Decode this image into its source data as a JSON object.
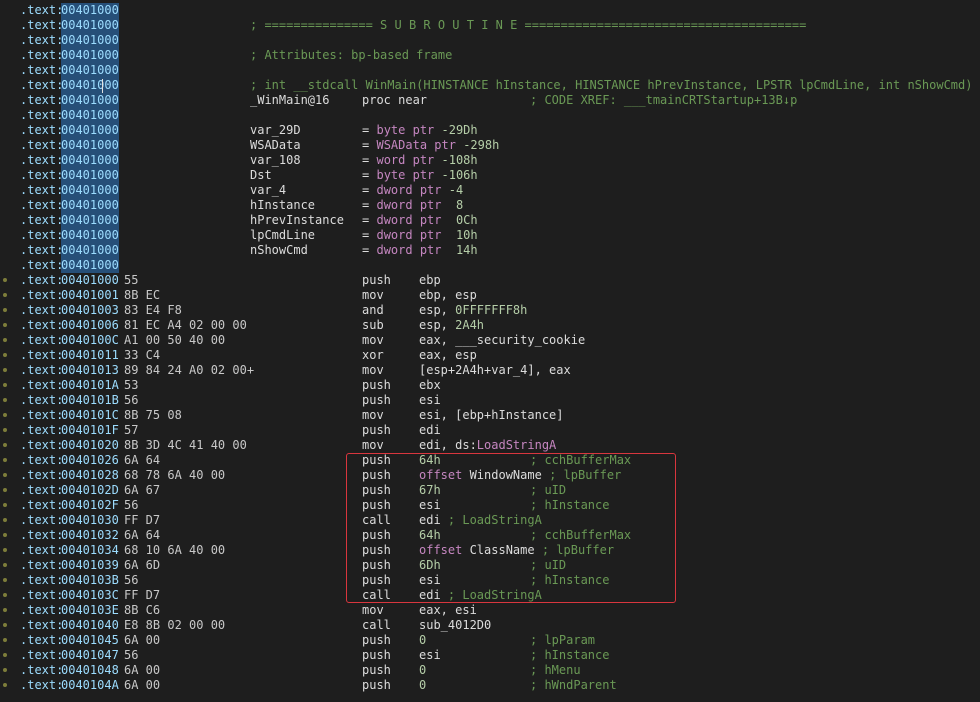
{
  "section": ".text:",
  "highlight_rows": 18,
  "lines": [
    {
      "addr": "00401000",
      "bytes": "",
      "kind": "blank"
    },
    {
      "addr": "00401000",
      "bytes": "",
      "kind": "full",
      "text": "; =============== S U B R O U T I N E ======================================="
    },
    {
      "addr": "00401000",
      "bytes": "",
      "kind": "blank"
    },
    {
      "addr": "00401000",
      "bytes": "",
      "kind": "full",
      "text": "; Attributes: bp-based frame"
    },
    {
      "addr": "00401000",
      "bytes": "",
      "kind": "blank"
    },
    {
      "addr": "00401000",
      "bytes": "",
      "kind": "full",
      "text": "; int __stdcall WinMain(HINSTANCE hInstance, HINSTANCE hPrevInstance, LPSTR lpCmdLine, int nShowCmd)"
    },
    {
      "addr": "00401000",
      "bytes": "",
      "kind": "proc",
      "label": "_WinMain@16",
      "mn": "proc near",
      "cm": "; CODE XREF: ___tmainCRTStartup+13B↓p"
    },
    {
      "addr": "00401000",
      "bytes": "",
      "kind": "blank"
    },
    {
      "addr": "00401000",
      "bytes": "",
      "kind": "var",
      "label": "var_29D",
      "eq": "=",
      "type": "byte ptr",
      "val": "-29Dh"
    },
    {
      "addr": "00401000",
      "bytes": "",
      "kind": "var",
      "label": "WSAData",
      "eq": "=",
      "type": "WSAData ptr",
      "val": "-298h"
    },
    {
      "addr": "00401000",
      "bytes": "",
      "kind": "var",
      "label": "var_108",
      "eq": "=",
      "type": "word ptr",
      "val": "-108h"
    },
    {
      "addr": "00401000",
      "bytes": "",
      "kind": "var",
      "label": "Dst",
      "eq": "=",
      "type": "byte ptr",
      "val": "-106h"
    },
    {
      "addr": "00401000",
      "bytes": "",
      "kind": "var",
      "label": "var_4",
      "eq": "=",
      "type": "dword ptr",
      "val": "-4"
    },
    {
      "addr": "00401000",
      "bytes": "",
      "kind": "var",
      "label": "hInstance",
      "eq": "=",
      "type": "dword ptr",
      "val": " 8"
    },
    {
      "addr": "00401000",
      "bytes": "",
      "kind": "var",
      "label": "hPrevInstance",
      "eq": "=",
      "type": "dword ptr",
      "val": " 0Ch"
    },
    {
      "addr": "00401000",
      "bytes": "",
      "kind": "var",
      "label": "lpCmdLine",
      "eq": "=",
      "type": "dword ptr",
      "val": " 10h"
    },
    {
      "addr": "00401000",
      "bytes": "",
      "kind": "var",
      "label": "nShowCmd",
      "eq": "=",
      "type": "dword ptr",
      "val": " 14h"
    },
    {
      "addr": "00401000",
      "bytes": "",
      "kind": "blank"
    },
    {
      "addr": "00401000",
      "bytes": "55",
      "kind": "ins",
      "dot": true,
      "mn": "push",
      "op": "ebp"
    },
    {
      "addr": "00401001",
      "bytes": "8B EC",
      "kind": "ins",
      "dot": true,
      "mn": "mov",
      "op": "ebp, esp"
    },
    {
      "addr": "00401003",
      "bytes": "83 E4 F8",
      "kind": "ins",
      "dot": true,
      "mn": "and",
      "op": "esp, ",
      "opn": "0FFFFFFF8h"
    },
    {
      "addr": "00401006",
      "bytes": "81 EC A4 02 00 00",
      "kind": "ins",
      "dot": true,
      "mn": "sub",
      "op": "esp, ",
      "opn": "2A4h"
    },
    {
      "addr": "0040100C",
      "bytes": "A1 00 50 40 00",
      "kind": "ins",
      "dot": true,
      "mn": "mov",
      "op": "eax, ___security_cookie"
    },
    {
      "addr": "00401011",
      "bytes": "33 C4",
      "kind": "ins",
      "dot": true,
      "mn": "xor",
      "op": "eax, esp"
    },
    {
      "addr": "00401013",
      "bytes": "89 84 24 A0 02 00+",
      "kind": "ins",
      "dot": true,
      "mn": "mov",
      "op": "[esp+2A4h+var_4], eax"
    },
    {
      "addr": "0040101A",
      "bytes": "53",
      "kind": "ins",
      "dot": true,
      "mn": "push",
      "op": "ebx"
    },
    {
      "addr": "0040101B",
      "bytes": "56",
      "kind": "ins",
      "dot": true,
      "mn": "push",
      "op": "esi"
    },
    {
      "addr": "0040101C",
      "bytes": "8B 75 08",
      "kind": "ins",
      "dot": true,
      "mn": "mov",
      "op": "esi, [ebp+hInstance]"
    },
    {
      "addr": "0040101F",
      "bytes": "57",
      "kind": "ins",
      "dot": true,
      "mn": "push",
      "op": "edi"
    },
    {
      "addr": "00401020",
      "bytes": "8B 3D 4C 41 40 00",
      "kind": "ins",
      "dot": true,
      "mn": "mov",
      "op": "edi, ds:",
      "opk": "LoadStringA"
    },
    {
      "addr": "00401026",
      "bytes": "6A 64",
      "kind": "ins",
      "dot": true,
      "mn": "push",
      "opn": "64h",
      "cm": "; cchBufferMax"
    },
    {
      "addr": "00401028",
      "bytes": "68 78 6A 40 00",
      "kind": "ins",
      "dot": true,
      "mn": "push",
      "opk": "offset",
      "op": " WindowName",
      "cmi": " ; lpBuffer"
    },
    {
      "addr": "0040102D",
      "bytes": "6A 67",
      "kind": "ins",
      "dot": true,
      "mn": "push",
      "opn": "67h",
      "cm": "; uID"
    },
    {
      "addr": "0040102F",
      "bytes": "56",
      "kind": "ins",
      "dot": true,
      "mn": "push",
      "op": "esi",
      "cm": "; hInstance"
    },
    {
      "addr": "00401030",
      "bytes": "FF D7",
      "kind": "ins",
      "dot": true,
      "mn": "call",
      "op": "edi",
      "cmi": " ; LoadStringA"
    },
    {
      "addr": "00401032",
      "bytes": "6A 64",
      "kind": "ins",
      "dot": true,
      "mn": "push",
      "opn": "64h",
      "cm": "; cchBufferMax"
    },
    {
      "addr": "00401034",
      "bytes": "68 10 6A 40 00",
      "kind": "ins",
      "dot": true,
      "mn": "push",
      "opk": "offset",
      "op": " ClassName",
      "cmi": " ; lpBuffer"
    },
    {
      "addr": "00401039",
      "bytes": "6A 6D",
      "kind": "ins",
      "dot": true,
      "mn": "push",
      "opn": "6Dh",
      "cm": "; uID"
    },
    {
      "addr": "0040103B",
      "bytes": "56",
      "kind": "ins",
      "dot": true,
      "mn": "push",
      "op": "esi",
      "cm": "; hInstance"
    },
    {
      "addr": "0040103C",
      "bytes": "FF D7",
      "kind": "ins",
      "dot": true,
      "mn": "call",
      "op": "edi",
      "cmi": " ; LoadStringA"
    },
    {
      "addr": "0040103E",
      "bytes": "8B C6",
      "kind": "ins",
      "dot": true,
      "mn": "mov",
      "op": "eax, esi"
    },
    {
      "addr": "00401040",
      "bytes": "E8 8B 02 00 00",
      "kind": "ins",
      "dot": true,
      "mn": "call",
      "op": "sub_4012D0"
    },
    {
      "addr": "00401045",
      "bytes": "6A 00",
      "kind": "ins",
      "dot": true,
      "mn": "push",
      "opn": "0",
      "cm": "; lpParam"
    },
    {
      "addr": "00401047",
      "bytes": "56",
      "kind": "ins",
      "dot": true,
      "mn": "push",
      "op": "esi",
      "cm": "; hInstance"
    },
    {
      "addr": "00401048",
      "bytes": "6A 00",
      "kind": "ins",
      "dot": true,
      "mn": "push",
      "opn": "0",
      "cm": "; hMenu"
    },
    {
      "addr": "0040104A",
      "bytes": "6A 00",
      "kind": "ins",
      "dot": true,
      "mn": "push",
      "opn": "0",
      "cm": "; hWndParent"
    }
  ]
}
